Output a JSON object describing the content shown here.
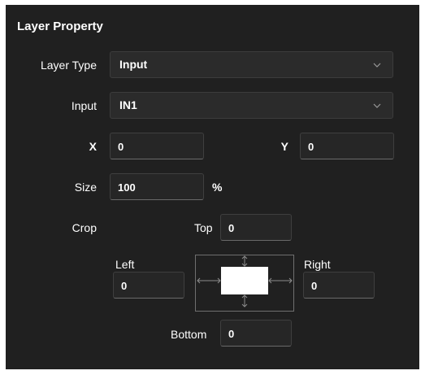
{
  "panel": {
    "title": "Layer Property"
  },
  "layer_type": {
    "label": "Layer Type",
    "value": "Input",
    "icon": "chevron-down-icon"
  },
  "input": {
    "label": "Input",
    "value": "IN1",
    "icon": "chevron-down-icon"
  },
  "position": {
    "x_label": "X",
    "x_value": "0",
    "y_label": "Y",
    "y_value": "0"
  },
  "size": {
    "label": "Size",
    "value": "100",
    "unit": "%"
  },
  "crop": {
    "label": "Crop",
    "top_label": "Top",
    "top_value": "0",
    "left_label": "Left",
    "left_value": "0",
    "right_label": "Right",
    "right_value": "0",
    "bottom_label": "Bottom",
    "bottom_value": "0"
  },
  "colors": {
    "panel_bg": "#202020",
    "field_bg": "#262626",
    "text": "#ffffff"
  }
}
